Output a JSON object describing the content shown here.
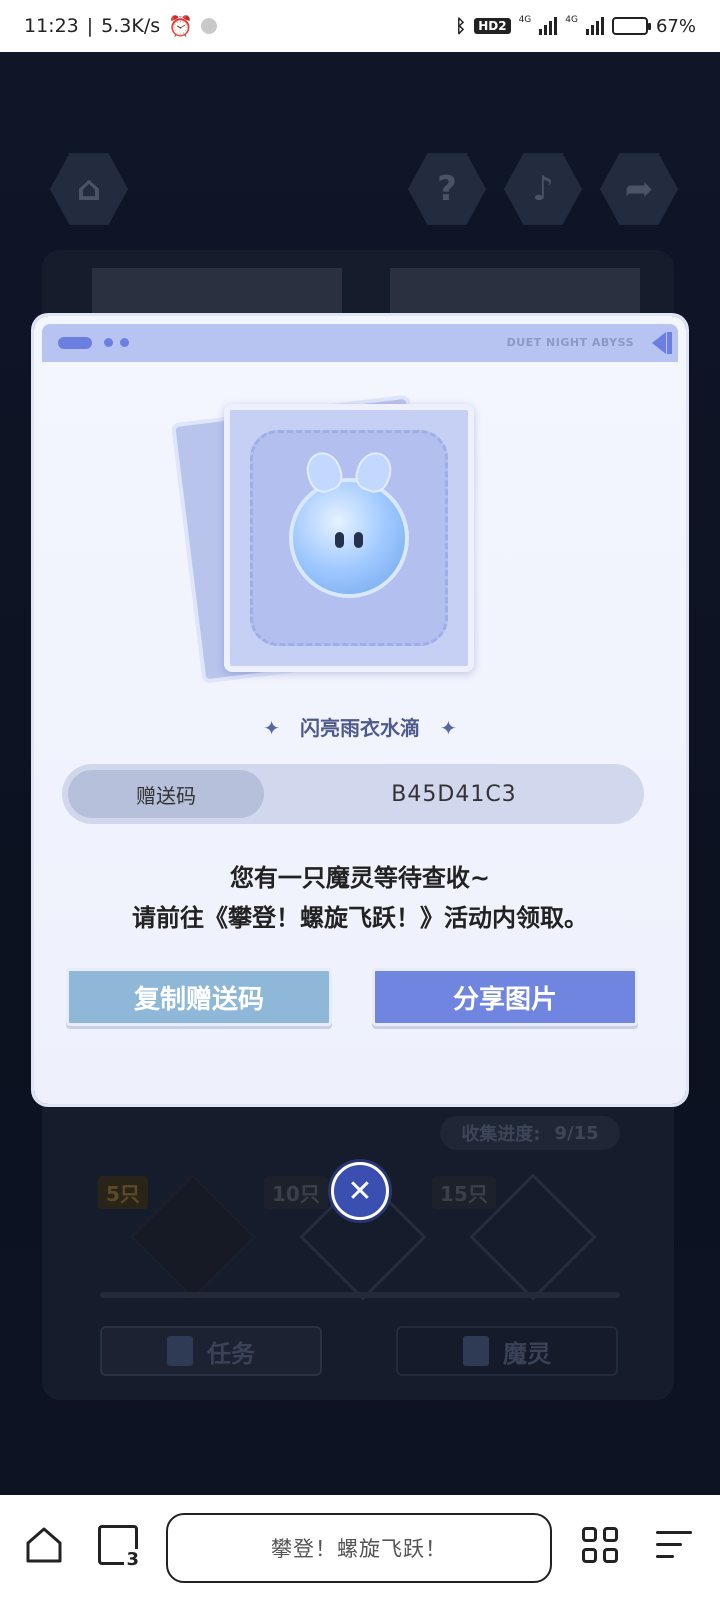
{
  "status_bar": {
    "time": "11:23",
    "speed": "5.3K/s",
    "alarm_icon": "alarm-icon",
    "hd_label": "HD2",
    "network_1": "4G",
    "network_2": "4G",
    "battery_percent": "67%",
    "battery_level": 0.67
  },
  "game_background": {
    "home_icon": "home-icon",
    "help_icon": "question-icon",
    "music_icon": "music-icon",
    "share_icon": "share-arrow-icon",
    "collect_label": "收集进度:",
    "collect_value": "9/15",
    "milestones": [
      "5只",
      "10只",
      "15只"
    ],
    "tabs": [
      "任务",
      "魔灵"
    ]
  },
  "modal": {
    "header_brand": "DUET NIGHT ABYSS",
    "item_name": "闪亮雨衣水滴",
    "code_label": "赠送码",
    "code_value": "B45D41C3",
    "message_line1": "您有一只魔灵等待查收~",
    "message_line2": "请前往《攀登！螺旋飞跃！》活动内领取。",
    "copy_button": "复制赠送码",
    "share_button": "分享图片",
    "colors": {
      "accent": "#7085e0",
      "copy_button": "#8fb8d8",
      "header": "#b7c3f0"
    }
  },
  "close_button": {
    "icon": "close-icon",
    "label": "✕"
  },
  "browser_bar": {
    "page_title": "攀登！螺旋飞跃！",
    "tab_count": "3",
    "home_icon": "home-outline-icon",
    "tabs_icon": "tabs-icon",
    "apps_icon": "apps-grid-icon",
    "menu_icon": "menu-icon"
  }
}
